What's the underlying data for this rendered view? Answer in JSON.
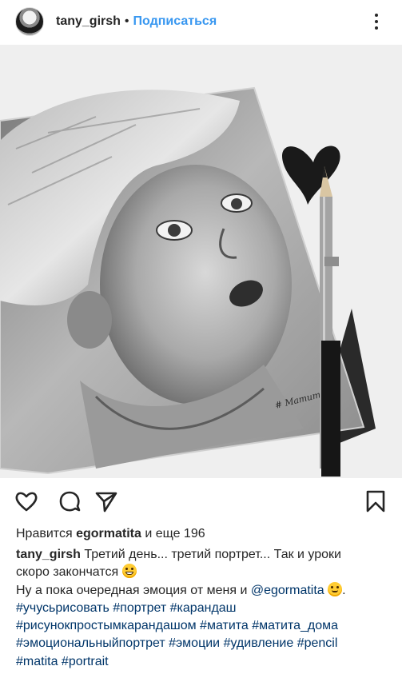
{
  "header": {
    "username": "tany_girsh",
    "separator": "•",
    "follow_label": "Подписаться"
  },
  "photo": {
    "signature": "# Матита",
    "icons": [
      "heart-eraser",
      "pencil",
      "sketchbook"
    ]
  },
  "actions": {
    "icons": [
      "heart-icon",
      "comment-icon",
      "share-icon",
      "bookmark-icon"
    ]
  },
  "likes": {
    "prefix": "Нравится",
    "user": "egormatita",
    "suffix": "и еще 196"
  },
  "caption": {
    "author": "tany_girsh",
    "line1": "Третий день... третий портрет... Так и уроки",
    "line2": "скоро закончатся",
    "line3_prefix": "Ну а пока очередная эмоция от меня и",
    "mention": "@egormatita",
    "line3_suffix": ".",
    "tags_line1": "#учусьрисовать #портрет #карандаш",
    "tags_line2": "#рисунокпростымкарандашом #матита #матита_дома",
    "tags_line3": "#эмоциональныйпортрет #эмоции #удивление #pencil",
    "tags_line4": "#matita #portrait"
  },
  "colors": {
    "text": "#262626",
    "link": "#003569",
    "follow": "#3897f0",
    "emoji": "#ffcc33"
  }
}
